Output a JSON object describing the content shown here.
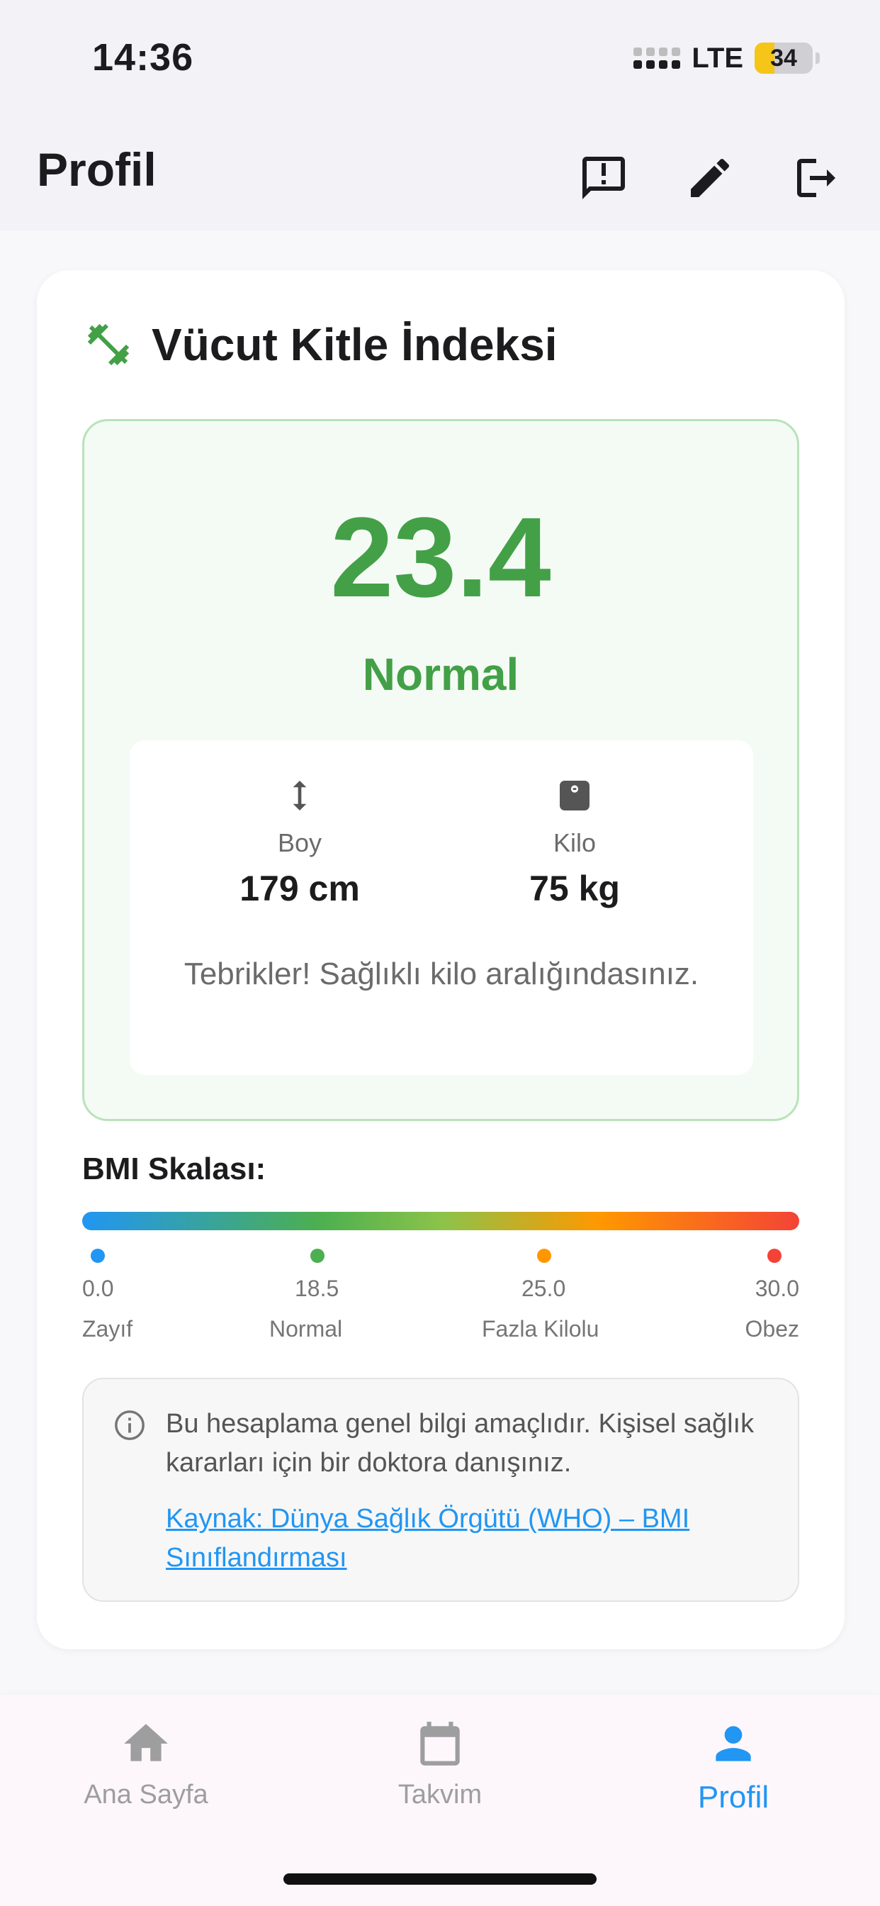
{
  "status_bar": {
    "time": "14:36",
    "network": "LTE",
    "battery_level": "34",
    "battery_percent": 34
  },
  "app_bar": {
    "title": "Profil"
  },
  "bmi_card": {
    "title": "Vücut Kitle İndeksi",
    "value": "23.4",
    "category": "Normal",
    "height_label": "Boy",
    "height_value": "179 cm",
    "weight_label": "Kilo",
    "weight_value": "75 kg",
    "message": "Tebrikler! Sağlıklı kilo aralığındasınız.",
    "accent_color": "#43a047"
  },
  "scale": {
    "title": "BMI Skalası:",
    "points": [
      {
        "value": "0.0",
        "label": "Zayıf",
        "color": "#2196f3"
      },
      {
        "value": "18.5",
        "label": "Normal",
        "color": "#4caf50"
      },
      {
        "value": "25.0",
        "label": "Fazla Kilolu",
        "color": "#ff9800"
      },
      {
        "value": "30.0",
        "label": "Obez",
        "color": "#f44336"
      }
    ]
  },
  "info": {
    "text": "Bu hesaplama genel bilgi amaçlıdır. Kişisel sağlık kararları için bir doktora danışınız.",
    "link": "Kaynak: Dünya Sağlık Örgütü (WHO) – BMI Sınıflandırması"
  },
  "bottom_nav": {
    "items": [
      {
        "label": "Ana Sayfa",
        "icon": "home-icon",
        "active": false
      },
      {
        "label": "Takvim",
        "icon": "calendar-icon",
        "active": false
      },
      {
        "label": "Profil",
        "icon": "person-icon",
        "active": true
      }
    ],
    "active_color": "#2196f3"
  }
}
